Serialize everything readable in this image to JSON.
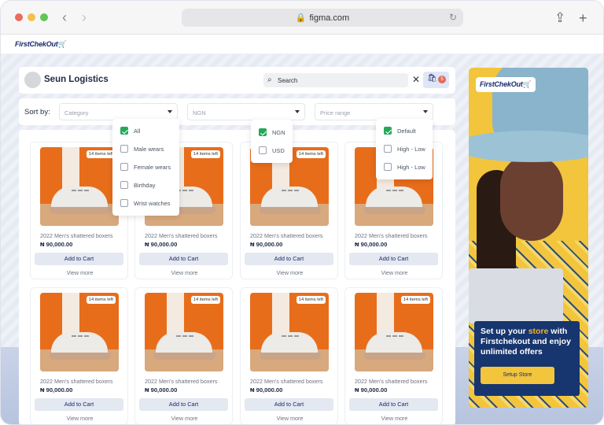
{
  "browser": {
    "url": "figma.com",
    "traffic_colors": [
      "#ec6a5e",
      "#f4bf4f",
      "#61c554"
    ]
  },
  "brand": {
    "logo_text": "FirstChekOut"
  },
  "header": {
    "store_name": "Seun Logistics",
    "search_placeholder": "Search",
    "cart_count": "5"
  },
  "filters": {
    "sort_label": "Sort by:",
    "category_placeholder": "Category",
    "currency_value": "NGN",
    "price_placeholder": "Price range",
    "category_options": [
      {
        "label": "All",
        "checked": true
      },
      {
        "label": "Male wears",
        "checked": false
      },
      {
        "label": "Female wears",
        "checked": false
      },
      {
        "label": "Birthday",
        "checked": false
      },
      {
        "label": "Wrist watches",
        "checked": false
      }
    ],
    "currency_options": [
      {
        "label": "NGN",
        "checked": true
      },
      {
        "label": "USD",
        "checked": false
      }
    ],
    "price_options": [
      {
        "label": "Default",
        "checked": true
      },
      {
        "label": "High - Low",
        "checked": false
      },
      {
        "label": "High - Low",
        "checked": false
      }
    ]
  },
  "products": [
    {
      "name": "2022 Men's shattered boxers",
      "price": "₦ 90,000.00",
      "stock": "14 items left",
      "add": "Add to Cart",
      "more": "View more"
    },
    {
      "name": "2022 Men's shattered boxers",
      "price": "₦ 90,000.00",
      "stock": "14 items left",
      "add": "Add to Cart",
      "more": "View more"
    },
    {
      "name": "2022 Men's shattered boxers",
      "price": "₦ 90,000.00",
      "stock": "14 items left",
      "add": "Add to Cart",
      "more": "View more"
    },
    {
      "name": "2022 Men's shattered boxers",
      "price": "₦ 90,000.00",
      "stock": "14 items left",
      "add": "Add to Cart",
      "more": "View more"
    },
    {
      "name": "2022 Men's shattered boxers",
      "price": "₦ 90,000.00",
      "stock": "14 items left",
      "add": "Add to Cart",
      "more": "View more"
    },
    {
      "name": "2022 Men's shattered boxers",
      "price": "₦ 90,000.00",
      "stock": "14 items left",
      "add": "Add to Cart",
      "more": "View more"
    },
    {
      "name": "2022 Men's shattered boxers",
      "price": "₦ 90,000.00",
      "stock": "14 items left",
      "add": "Add to Cart",
      "more": "View more"
    },
    {
      "name": "2022 Men's shattered boxers",
      "price": "₦ 90,000.00",
      "stock": "14 items left",
      "add": "Add to Cart",
      "more": "View more"
    }
  ],
  "ad": {
    "logo_text": "FirstChekOut",
    "headline_pre": "Set up your ",
    "headline_hl": "store",
    "headline_post": " with Firstchekout and enjoy unlimited offers",
    "button": "Setup Store"
  }
}
